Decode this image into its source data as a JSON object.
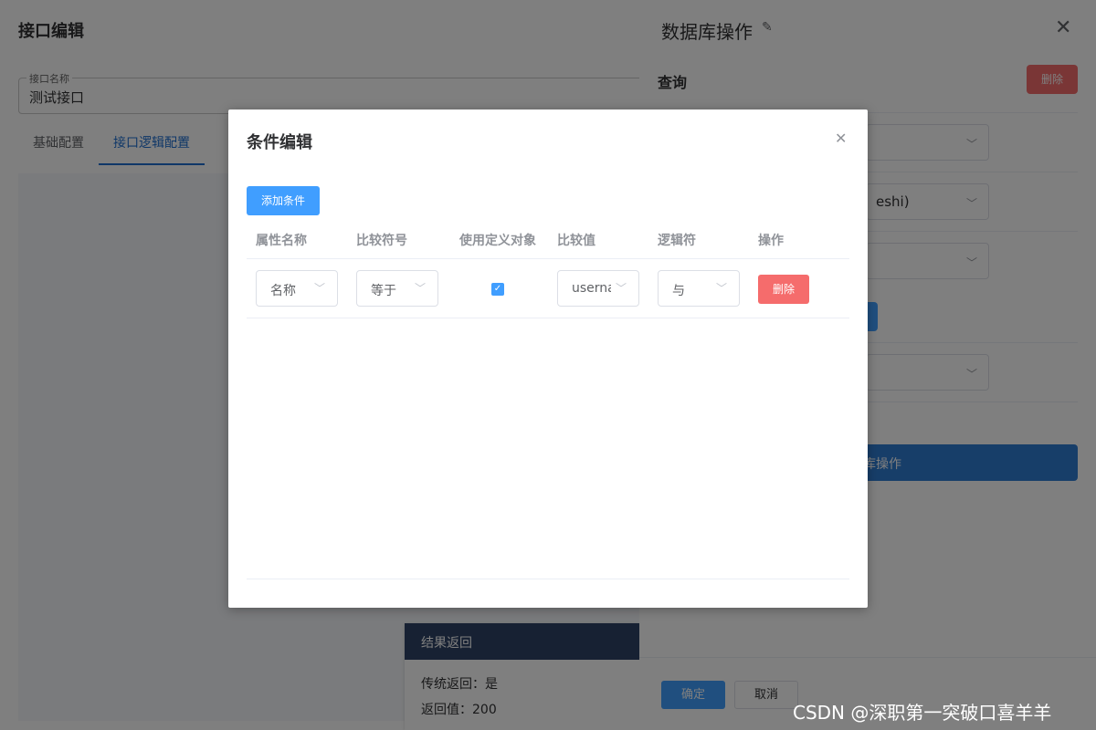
{
  "page": {
    "title": "接口编辑",
    "name_field": {
      "legend": "接口名称",
      "value": "测试接口"
    },
    "tabs": [
      {
        "label": "基础配置",
        "active": false
      },
      {
        "label": "接口逻辑配置",
        "active": true
      }
    ],
    "result_card": {
      "title": "结果返回",
      "lines": [
        "传统返回：是",
        "返回值：200"
      ]
    }
  },
  "drawer": {
    "title": "数据库操作",
    "edit_icon": "pencil-icon",
    "close_icon": "close-icon",
    "section_label": "查询",
    "delete_label": "删除",
    "select_texts": [
      "",
      "eshi)",
      "",
      ""
    ],
    "wide_button_label": "库操作",
    "confirm_label": "确定",
    "cancel_label": "取消"
  },
  "dialog": {
    "title": "条件编辑",
    "close_icon": "close-icon",
    "add_label": "添加条件",
    "columns": [
      "属性名称",
      "比较符号",
      "使用定义对象",
      "比较值",
      "逻辑符",
      "操作"
    ],
    "rows": [
      {
        "attribute": "名称",
        "operator": "等于",
        "use_defined_object": true,
        "value": "userna",
        "logic": "与",
        "action_label": "删除"
      }
    ]
  },
  "watermark": "CSDN @深职第一突破口喜羊羊",
  "colors": {
    "primary": "#409eff",
    "danger": "#f56c6c",
    "tab_active": "#1f6fd1",
    "result_header": "#2f4366"
  }
}
